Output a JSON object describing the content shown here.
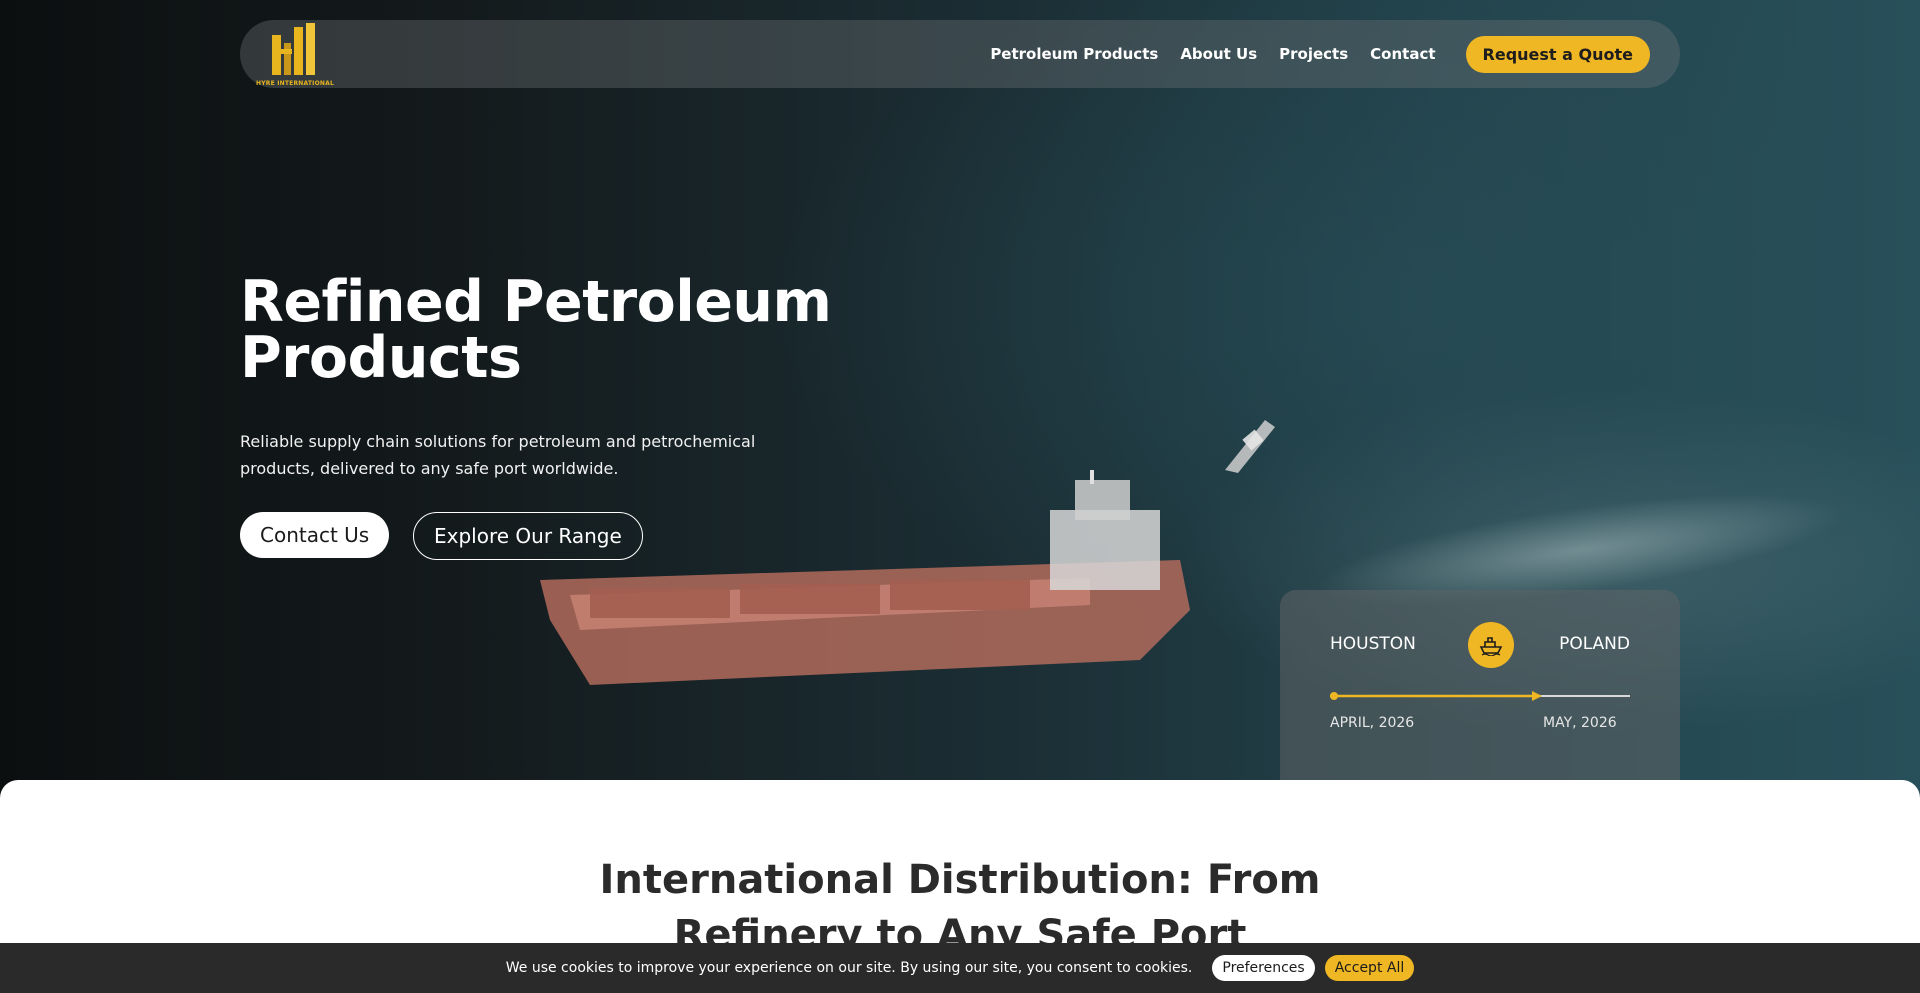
{
  "nav": {
    "logo_text": "HYRE INTERNATIONAL",
    "links": [
      "Petroleum Products",
      "About Us",
      "Projects",
      "Contact"
    ],
    "cta_label": "Request a Quote"
  },
  "hero": {
    "title": "Refined Petroleum Products",
    "subtitle": "Reliable supply chain solutions for petroleum and petrochemical products, delivered to any safe port worldwide.",
    "contact_label": "Contact Us",
    "explore_label": "Explore Our Range"
  },
  "route": {
    "origin": "HOUSTON",
    "destination": "POLAND",
    "origin_date": "APRIL, 2026",
    "destination_date": "MAY, 2026",
    "progress": 0.7,
    "icon": "ship-icon"
  },
  "section": {
    "title": "International Distribution: From Refinery to Any Safe Port"
  },
  "cookie": {
    "message": "We use cookies to improve your experience on our site. By using our site, you consent to cookies.",
    "preferences_label": "Preferences",
    "accept_label": "Accept All"
  },
  "colors": {
    "accent": "#f0b724",
    "dark": "#2a2a2a"
  }
}
